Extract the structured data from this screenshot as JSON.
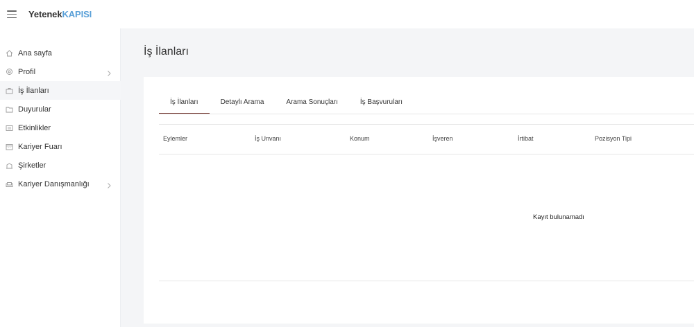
{
  "topbar": {
    "brand_part1": "Yetenek",
    "brand_part2": "KAPISI"
  },
  "sidebar": {
    "items": [
      {
        "label": "Ana sayfa",
        "icon": "home-icon",
        "has_submenu": false
      },
      {
        "label": "Profil",
        "icon": "gear-icon",
        "has_submenu": true
      },
      {
        "label": "İş İlanları",
        "icon": "briefcase-icon",
        "has_submenu": false,
        "active": true
      },
      {
        "label": "Duyurular",
        "icon": "folder-icon",
        "has_submenu": false
      },
      {
        "label": "Etkinlikler",
        "icon": "list-icon",
        "has_submenu": false
      },
      {
        "label": "Kariyer Fuarı",
        "icon": "calendar-icon",
        "has_submenu": false
      },
      {
        "label": "Şirketler",
        "icon": "building-icon",
        "has_submenu": false
      },
      {
        "label": "Kariyer Danışmanlığı",
        "icon": "sofa-icon",
        "has_submenu": true
      }
    ]
  },
  "main": {
    "page_title": "İş İlanları",
    "tabs": [
      {
        "label": "İş İlanları",
        "active": true
      },
      {
        "label": "Detaylı Arama"
      },
      {
        "label": "Arama Sonuçları"
      },
      {
        "label": "İş Başvuruları"
      }
    ],
    "table": {
      "columns": [
        "Eylemler",
        "İş Unvanı",
        "Konum",
        "İşveren",
        "İrtibat",
        "Pozisyon Tipi"
      ],
      "empty_message": "Kayıt bulunamadı"
    }
  },
  "colors": {
    "brand_accent": "#5aa0d8",
    "tab_active_underline": "#6b2a23"
  }
}
